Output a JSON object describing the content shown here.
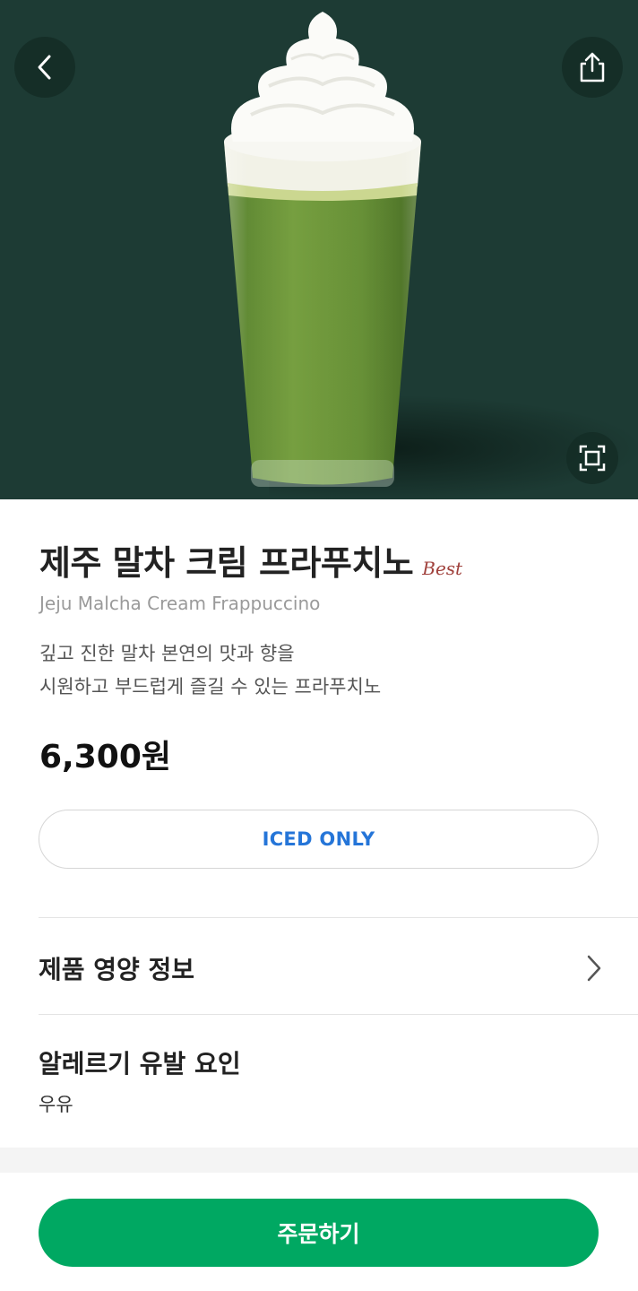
{
  "product": {
    "name_ko": "제주 말차 크림 프라푸치노",
    "badge": "Best",
    "name_en": "Jeju Malcha Cream Frappuccino",
    "description_line1": "깊고 진한 말차 본연의 맛과 향을",
    "description_line2": "시원하고 부드럽게 즐길 수 있는 프라푸치노",
    "price": "6,300원",
    "temperature_option": "ICED ONLY"
  },
  "sections": {
    "nutrition_label": "제품 영양 정보",
    "allergy_label": "알레르기 유발 요인",
    "allergy_value": "우유"
  },
  "actions": {
    "order_label": "주문하기"
  },
  "icons": {
    "back": "chevron-left-icon",
    "share": "share-icon",
    "zoom": "expand-icon",
    "nutrition_arrow": "chevron-right-icon"
  },
  "colors": {
    "hero_background": "#1d3b34",
    "order_button": "#00a862",
    "iced_text": "#2575d8",
    "best_badge": "#a0413c"
  }
}
